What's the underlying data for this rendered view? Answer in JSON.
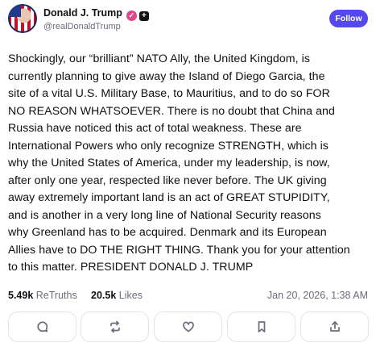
{
  "author": {
    "name": "Donald J. Trump",
    "handle": "@realDonaldTrump",
    "verified_icon": "verified-badge-icon",
    "plus_icon": "plus-badge-icon"
  },
  "follow_label": "Follow",
  "post": {
    "lines": [
      "Shockingly, our “brilliant” NATO Ally, the United Kingdom, is",
      "currently planning to give away the Island of Diego Garcia, the",
      "site of a vital U.S. Military Base, to Mauritius, and to do so FOR",
      "NO REASON WHATSOEVER. There is no doubt that China and",
      "Russia have noticed this act of total weakness. These are",
      "International Powers who only recognize STRENGTH, which is",
      "why the United States of America, under my leadership, is now,",
      "after only one year, respected like never before. The UK giving",
      "away extremely important land is an act of GREAT STUPIDITY,",
      "and is another in a very long line of National Security reasons",
      "why Greenland has to be acquired. Denmark and its European",
      "Allies have to DO THE RIGHT THING. Thank you for your attention",
      "to this matter. PRESIDENT DONALD J. TRUMP"
    ]
  },
  "stats": {
    "retruths_count": "5.49k",
    "retruths_label": "ReTruths",
    "likes_count": "20.5k",
    "likes_label": "Likes",
    "timestamp": "Jan 20, 2026, 1:38 AM"
  },
  "actions": [
    "reply-icon",
    "retruth-icon",
    "like-icon",
    "bookmark-icon",
    "share-icon"
  ],
  "colors": {
    "accent": "#5448ee",
    "muted_text": "#6b6b7b",
    "border": "#e3e3ea"
  }
}
